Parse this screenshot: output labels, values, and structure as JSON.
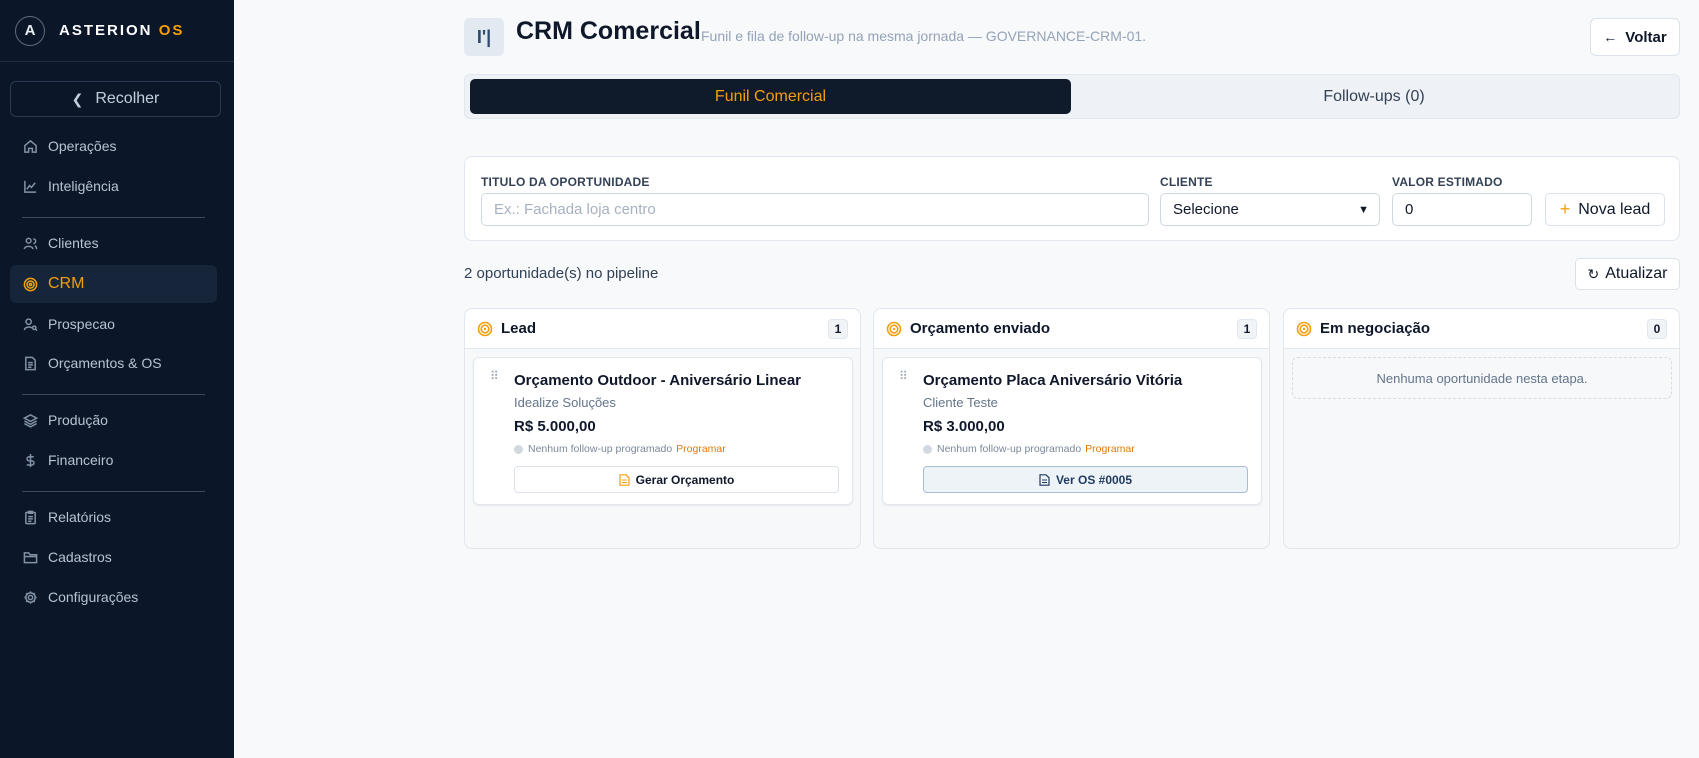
{
  "brand": {
    "name": "ASTERION",
    "accent": "OS",
    "logo_letter": "A"
  },
  "sidebar": {
    "collapse_label": "Recolher",
    "items": [
      {
        "label": "Operações",
        "icon": "home-icon"
      },
      {
        "label": "Inteligência",
        "icon": "chart-line-icon"
      },
      {
        "label": "Clientes",
        "icon": "users-icon"
      },
      {
        "label": "CRM",
        "icon": "target-icon",
        "active": true
      },
      {
        "label": "Prospecao",
        "icon": "user-search-icon"
      },
      {
        "label": "Orçamentos & OS",
        "icon": "document-icon"
      },
      {
        "label": "Produção",
        "icon": "layers-icon"
      },
      {
        "label": "Financeiro",
        "icon": "dollar-icon"
      },
      {
        "label": "Relatórios",
        "icon": "clipboard-icon"
      },
      {
        "label": "Cadastros",
        "icon": "folder-icon"
      },
      {
        "label": "Configurações",
        "icon": "gear-icon"
      }
    ]
  },
  "header": {
    "icon_glyph": "I'|",
    "title": "CRM Comercial",
    "subtitle": "Funil e fila de follow-up na mesma jornada — GOVERNANCE-CRM-01.",
    "back_label": "Voltar"
  },
  "tabs": [
    {
      "label": "Funil Comercial",
      "active": true
    },
    {
      "label": "Follow-ups (0)",
      "active": false
    }
  ],
  "form": {
    "title_label": "TITULO DA OPORTUNIDADE",
    "title_placeholder": "Ex.: Fachada loja centro",
    "client_label": "CLIENTE",
    "client_value": "Selecione",
    "value_label": "VALOR ESTIMADO",
    "value_value": "0",
    "new_lead_label": "Nova lead"
  },
  "pipeline": {
    "count_text": "2 oportunidade(s) no pipeline",
    "refresh_label": "Atualizar"
  },
  "columns": [
    {
      "title": "Lead",
      "count": "1",
      "card": {
        "title": "Orçamento Outdoor - Aniversário Linear",
        "client": "Idealize Soluções",
        "value": "R$ 5.000,00",
        "followup": "Nenhum follow-up programado",
        "schedule_label": "Programar",
        "button_label": "Gerar Orçamento"
      }
    },
    {
      "title": "Orçamento enviado",
      "count": "1",
      "card": {
        "title": "Orçamento Placa Aniversário Vitória",
        "client": "Cliente Teste",
        "value": "R$ 3.000,00",
        "followup": "Nenhum follow-up programado",
        "schedule_label": "Programar",
        "button_label": "Ver OS #0005"
      }
    },
    {
      "title": "Em negociação",
      "count": "0",
      "empty_text": "Nenhuma oportunidade nesta etapa."
    }
  ],
  "colors": {
    "accent": "#f59e0b",
    "sidebar_bg": "#0b1628",
    "active_tab_bg": "#0f1a2b"
  }
}
